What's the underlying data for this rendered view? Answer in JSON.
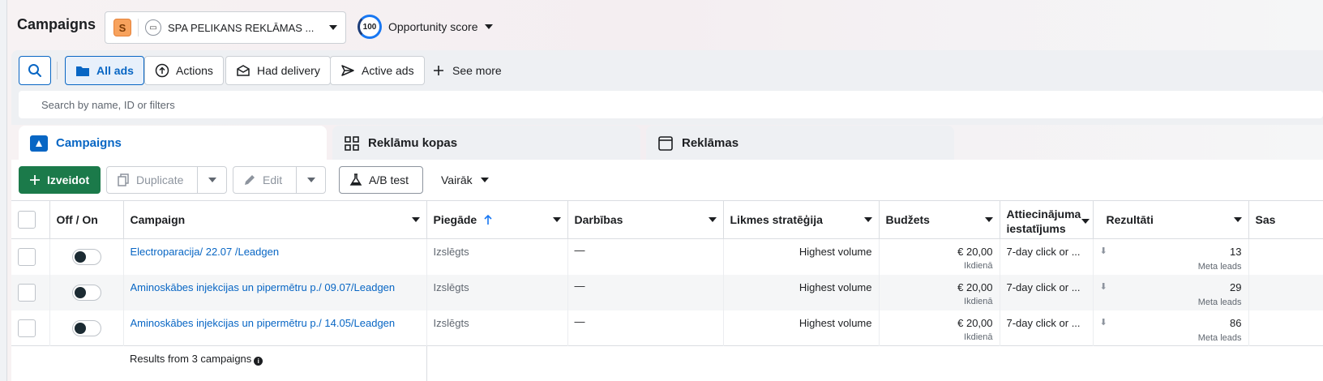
{
  "header": {
    "title": "Campaigns",
    "account": {
      "badge": "S",
      "name": "SPA PELIKANS REKLĀMAS ..."
    },
    "opportunity": {
      "score": "100",
      "label": "Opportunity score"
    }
  },
  "filters": {
    "buttons": [
      {
        "label": "All ads",
        "icon": "folder-icon",
        "active": true
      },
      {
        "label": "Actions",
        "icon": "upload-circle-icon"
      },
      {
        "label": "Had delivery",
        "icon": "envelope-icon"
      },
      {
        "label": "Active ads",
        "icon": "send-icon"
      }
    ],
    "see_more": "See more",
    "search_placeholder": "Search by name, ID or filters"
  },
  "tabs": [
    {
      "label": "Campaigns",
      "selected": true
    },
    {
      "label": "Reklāmu kopas"
    },
    {
      "label": "Reklāmas"
    }
  ],
  "toolbar": {
    "create": "Izveidot",
    "duplicate": "Duplicate",
    "edit": "Edit",
    "ab_test": "A/B test",
    "more": "Vairāk"
  },
  "table": {
    "columns": {
      "toggle": "Off / On",
      "campaign": "Campaign",
      "delivery": "Piegāde",
      "actions": "Darbības",
      "bid": "Likmes stratēģija",
      "budget": "Budžets",
      "attribution_1": "Attiecinājuma",
      "attribution_2": "iestatījums",
      "results": "Rezultāti",
      "next": "Sas"
    },
    "rows": [
      {
        "name": "Electroparacija/ 22.07 /Leadgen",
        "delivery": "Izslēgts",
        "actions": "—",
        "bid": "Highest volume",
        "budget": "€ 20,00",
        "budget_period": "Ikdienā",
        "attribution": "7-day click or ...",
        "results": "13",
        "results_type": "Meta leads"
      },
      {
        "name": "Aminoskābes injekcijas un pipermētru p./ 09.07/Leadgen",
        "delivery": "Izslēgts",
        "actions": "—",
        "bid": "Highest volume",
        "budget": "€ 20,00",
        "budget_period": "Ikdienā",
        "attribution": "7-day click or ...",
        "results": "29",
        "results_type": "Meta leads"
      },
      {
        "name": "Aminoskābes injekcijas un pipermētru p./ 14.05/Leadgen",
        "delivery": "Izslēgts",
        "actions": "—",
        "bid": "Highest volume",
        "budget": "€ 20,00",
        "budget_period": "Ikdienā",
        "attribution": "7-day click or ...",
        "results": "86",
        "results_type": "Meta leads"
      }
    ],
    "footer": "Results from 3 campaigns"
  },
  "colors": {
    "accent": "#0866c4",
    "create_button": "#1b7a4a"
  }
}
